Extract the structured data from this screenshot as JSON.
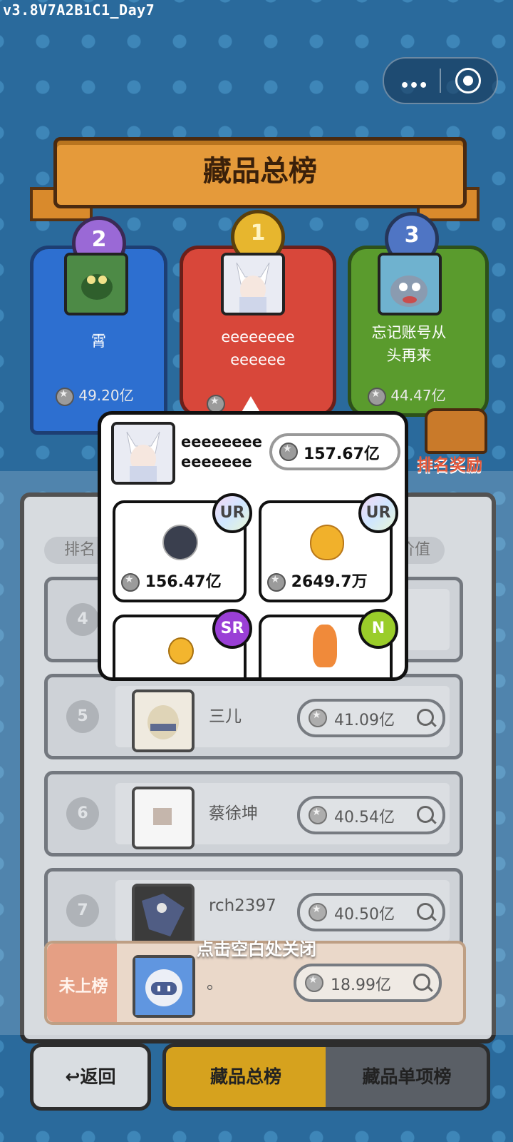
{
  "version_label": "v3.8V7A2B1C1_Day7",
  "banner_title": "藏品总榜",
  "podium": [
    {
      "rank": "2",
      "name": "霄",
      "value": "49.20亿"
    },
    {
      "rank": "1",
      "name": "eeeeeeeeeeeeeee",
      "value": "157.67亿"
    },
    {
      "rank": "3",
      "name": "忘记账号从头再来",
      "value": "44.47亿"
    }
  ],
  "podium_name_lines": {
    "first": [
      "eeeeeeee",
      "eeeeee"
    ],
    "third": [
      "忘记账号从",
      "头再来"
    ]
  },
  "reward_label": "排名奖励",
  "header": {
    "rank": "排名",
    "value": "价值"
  },
  "popup": {
    "name_lines": [
      "eeeeeeee",
      "eeeeeee"
    ],
    "total_value": "157.67亿",
    "items": [
      {
        "rarity": "UR",
        "value": "156.47亿",
        "icon": "character-card-icon"
      },
      {
        "rarity": "UR",
        "value": "2649.7万",
        "icon": "golden-apple-icon"
      },
      {
        "rarity": "SR",
        "value": "",
        "icon": "gold-medal-icon"
      },
      {
        "rarity": "N",
        "value": "",
        "icon": "koi-fish-icon"
      }
    ]
  },
  "rows": [
    {
      "rank": "4",
      "name": "",
      "value": ""
    },
    {
      "rank": "5",
      "name": "三儿",
      "value": "41.09亿"
    },
    {
      "rank": "6",
      "name": "蔡徐坤",
      "value": "40.54亿"
    },
    {
      "rank": "7",
      "name": "rch2397",
      "value": "40.50亿"
    }
  ],
  "my_row": {
    "rank_label": "未上榜",
    "name": "。",
    "value": "18.99亿"
  },
  "hint": "点击空白处关闭",
  "nav": {
    "back": "返回",
    "tab_total": "藏品总榜",
    "tab_single": "藏品单项榜"
  },
  "colors": {
    "first": "#d8473a",
    "second": "#2d6fd0",
    "third": "#5a9b2d",
    "active_tab": "#d6a21e"
  }
}
